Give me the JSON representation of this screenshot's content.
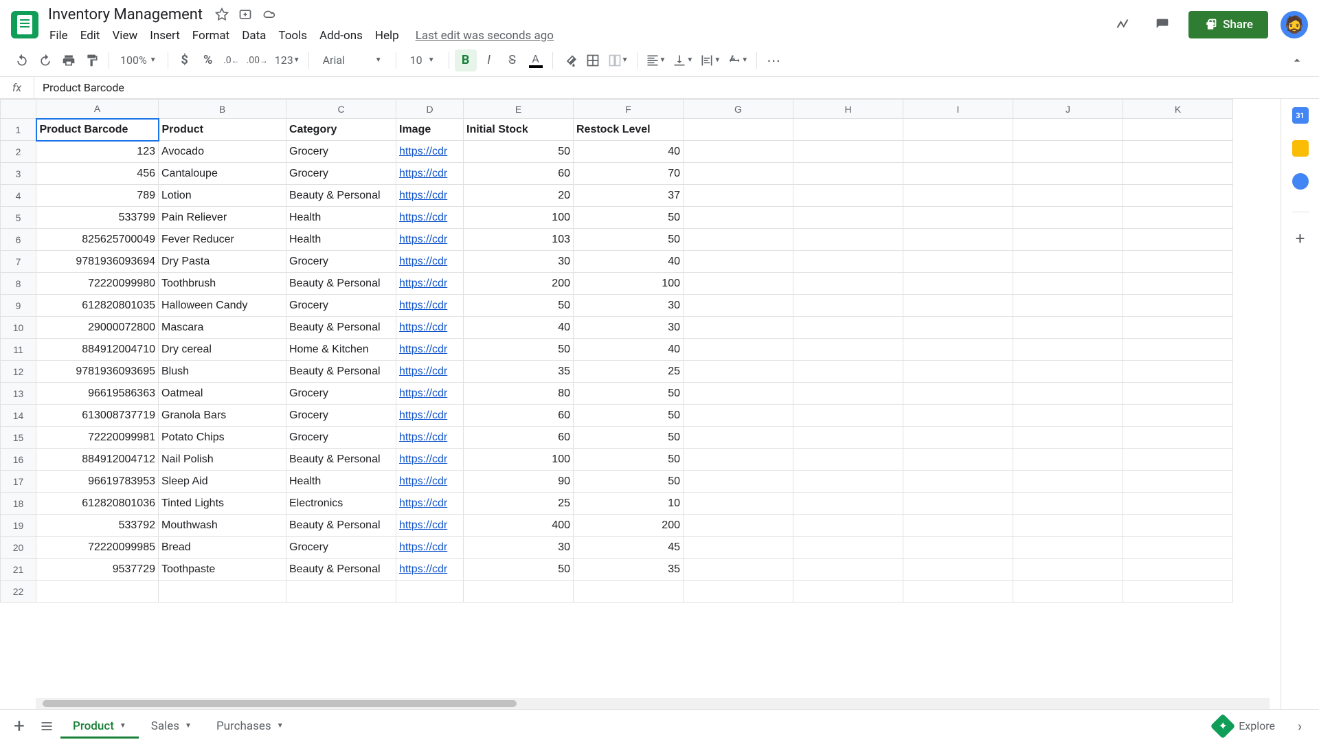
{
  "doc": {
    "title": "Inventory Management",
    "last_edit": "Last edit was seconds ago"
  },
  "menus": [
    "File",
    "Edit",
    "View",
    "Insert",
    "Format",
    "Data",
    "Tools",
    "Add-ons",
    "Help"
  ],
  "share_label": "Share",
  "toolbar": {
    "zoom": "100%",
    "font": "Arial",
    "font_size": "10",
    "number_fmt": "123"
  },
  "formula_bar": {
    "value": "Product Barcode"
  },
  "columns": [
    "A",
    "B",
    "C",
    "D",
    "E",
    "F",
    "G",
    "H",
    "I",
    "J",
    "K"
  ],
  "headers": [
    "Product Barcode",
    "Product",
    "Category",
    "Image",
    "Initial Stock",
    "Restock Level"
  ],
  "rows": [
    {
      "barcode": "123",
      "product": "Avocado",
      "category": "Grocery",
      "image": "https://cdr",
      "stock": "50",
      "restock": "40"
    },
    {
      "barcode": "456",
      "product": "Cantaloupe",
      "category": "Grocery",
      "image": "https://cdr",
      "stock": "60",
      "restock": "70"
    },
    {
      "barcode": "789",
      "product": "Lotion",
      "category": "Beauty & Personal",
      "image": "https://cdr",
      "stock": "20",
      "restock": "37"
    },
    {
      "barcode": "533799",
      "product": "Pain Reliever",
      "category": "Health",
      "image": "https://cdr",
      "stock": "100",
      "restock": "50"
    },
    {
      "barcode": "825625700049",
      "product": "Fever Reducer",
      "category": "Health",
      "image": "https://cdr",
      "stock": "103",
      "restock": "50"
    },
    {
      "barcode": "9781936093694",
      "product": "Dry Pasta",
      "category": "Grocery",
      "image": "https://cdr",
      "stock": "30",
      "restock": "40"
    },
    {
      "barcode": "72220099980",
      "product": "Toothbrush",
      "category": "Beauty & Personal",
      "image": "https://cdr",
      "stock": "200",
      "restock": "100"
    },
    {
      "barcode": "612820801035",
      "product": "Halloween Candy",
      "category": "Grocery",
      "image": "https://cdr",
      "stock": "50",
      "restock": "30"
    },
    {
      "barcode": "29000072800",
      "product": "Mascara",
      "category": "Beauty & Personal",
      "image": "https://cdr",
      "stock": "40",
      "restock": "30"
    },
    {
      "barcode": "884912004710",
      "product": "Dry cereal",
      "category": "Home & Kitchen",
      "image": "https://cdr",
      "stock": "50",
      "restock": "40"
    },
    {
      "barcode": "9781936093695",
      "product": "Blush",
      "category": "Beauty & Personal",
      "image": "https://cdr",
      "stock": "35",
      "restock": "25"
    },
    {
      "barcode": "96619586363",
      "product": "Oatmeal",
      "category": "Grocery",
      "image": "https://cdr",
      "stock": "80",
      "restock": "50"
    },
    {
      "barcode": "613008737719",
      "product": "Granola Bars",
      "category": "Grocery",
      "image": "https://cdr",
      "stock": "60",
      "restock": "50"
    },
    {
      "barcode": "72220099981",
      "product": "Potato Chips",
      "category": "Grocery",
      "image": "https://cdr",
      "stock": "60",
      "restock": "50"
    },
    {
      "barcode": "884912004712",
      "product": "Nail Polish",
      "category": "Beauty & Personal",
      "image": "https://cdr",
      "stock": "100",
      "restock": "50"
    },
    {
      "barcode": "96619783953",
      "product": "Sleep Aid",
      "category": "Health",
      "image": "https://cdr",
      "stock": "90",
      "restock": "50"
    },
    {
      "barcode": "612820801036",
      "product": "Tinted Lights",
      "category": "Electronics",
      "image": "https://cdr",
      "stock": "25",
      "restock": "10"
    },
    {
      "barcode": "533792",
      "product": "Mouthwash",
      "category": "Beauty & Personal",
      "image": "https://cdr",
      "stock": "400",
      "restock": "200"
    },
    {
      "barcode": "72220099985",
      "product": "Bread",
      "category": "Grocery",
      "image": "https://cdr",
      "stock": "30",
      "restock": "45"
    },
    {
      "barcode": "9537729",
      "product": "Toothpaste",
      "category": "Beauty & Personal",
      "image": "https://cdr",
      "stock": "50",
      "restock": "35"
    }
  ],
  "sheet_tabs": [
    {
      "name": "Product",
      "active": true
    },
    {
      "name": "Sales",
      "active": false
    },
    {
      "name": "Purchases",
      "active": false
    }
  ],
  "explore_label": "Explore"
}
